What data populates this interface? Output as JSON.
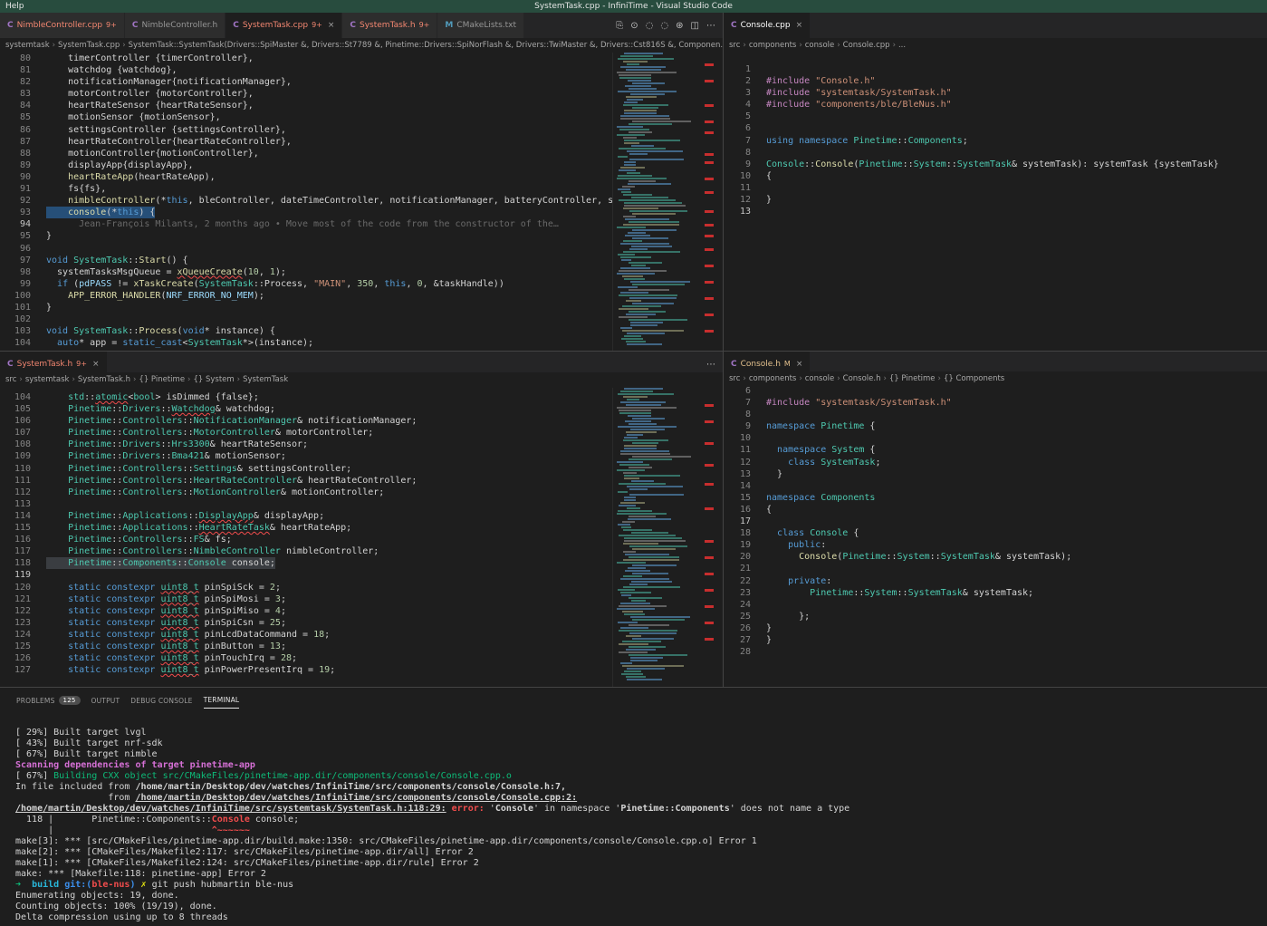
{
  "window": {
    "menu": "Help",
    "title": "SystemTask.cpp - InfiniTime - Visual Studio Code"
  },
  "colors": {
    "titlebar": "#284c3e",
    "error": "#f14c4c",
    "keyword": "#569cd6",
    "type": "#4ec9b0"
  },
  "top_left": {
    "tabs": [
      {
        "icon": "C",
        "label": "NimbleController.cpp",
        "badge": "9+",
        "state": "error"
      },
      {
        "icon": "C",
        "label": "NimbleController.h",
        "badge": "",
        "state": "normal"
      },
      {
        "icon": "C",
        "label": "SystemTask.cpp",
        "badge": "9+",
        "state": "active-error"
      },
      {
        "icon": "C",
        "label": "SystemTask.h",
        "badge": "9+",
        "state": "error"
      },
      {
        "icon": "M",
        "label": "CMakeLists.txt",
        "badge": "",
        "state": "normal"
      }
    ],
    "breadcrumb": [
      "systemtask",
      "SystemTask.cpp",
      "SystemTask::SystemTask(Drivers::SpiMaster &, Drivers::St7789 &, Pinetime::Drivers::SpiNorFlash &, Drivers::TwiMaster &, Drivers::Cst816S &, Componen..."
    ],
    "blame": "Jean-François Milants, 2 months ago • Move most of the code from the constructor of the…"
  },
  "top_right": {
    "tabs": [
      {
        "icon": "C",
        "label": "Console.cpp",
        "badge": "",
        "state": "active"
      }
    ],
    "breadcrumb": [
      "src",
      "components",
      "console",
      "Console.cpp",
      "..."
    ]
  },
  "bottom_left": {
    "tabs": [
      {
        "icon": "C",
        "label": "SystemTask.h",
        "badge": "9+",
        "state": "active-error"
      }
    ],
    "breadcrumb": [
      "src",
      "systemtask",
      "SystemTask.h",
      "{} Pinetime",
      "{} System",
      "SystemTask"
    ]
  },
  "bottom_right": {
    "tabs": [
      {
        "icon": "C",
        "label": "Console.h",
        "badge": "M",
        "state": "active-mod"
      }
    ],
    "breadcrumb": [
      "src",
      "components",
      "console",
      "Console.h",
      "{} Pinetime",
      "{} Components"
    ]
  },
  "panel": {
    "tabs": [
      {
        "label": "PROBLEMS",
        "badge": "125"
      },
      {
        "label": "OUTPUT",
        "badge": ""
      },
      {
        "label": "DEBUG CONSOLE",
        "badge": ""
      },
      {
        "label": "TERMINAL",
        "badge": ""
      }
    ],
    "active_tab": "TERMINAL"
  },
  "code": {
    "systemtask_cpp": [
      {
        "n": "80",
        "t": "    timerController {timerController},"
      },
      {
        "n": "81",
        "t": "    watchdog {watchdog},"
      },
      {
        "n": "82",
        "t": "    notificationManager{notificationManager},"
      },
      {
        "n": "83",
        "t": "    motorController {motorController},"
      },
      {
        "n": "84",
        "t": "    heartRateSensor {heartRateSensor},"
      },
      {
        "n": "85",
        "t": "    motionSensor {motionSensor},"
      },
      {
        "n": "86",
        "t": "    settingsController {settingsController},"
      },
      {
        "n": "87",
        "t": "    heartRateController{heartRateController},"
      },
      {
        "n": "88",
        "t": "    motionController{motionController},"
      },
      {
        "n": "89",
        "t": "    displayApp{displayApp},"
      },
      {
        "n": "90",
        "t": "    heartRateApp(heartRateApp),"
      },
      {
        "n": "91",
        "t": "    fs{fs},"
      },
      {
        "n": "92",
        "t": "    nimbleController(*this, bleController, dateTimeController, notificationManager, batteryController, spiN"
      },
      {
        "n": "93",
        "t": "    console(*this) {"
      },
      {
        "n": "94",
        "t": ""
      },
      {
        "n": "95",
        "t": "}"
      },
      {
        "n": "96",
        "t": ""
      },
      {
        "n": "97",
        "t": "void SystemTask::Start() {"
      },
      {
        "n": "98",
        "t": "  systemTasksMsgQueue = xQueueCreate(10, 1);"
      },
      {
        "n": "99",
        "t": "  if (pdPASS != xTaskCreate(SystemTask::Process, \"MAIN\", 350, this, 0, &taskHandle))"
      },
      {
        "n": "100",
        "t": "    APP_ERROR_HANDLER(NRF_ERROR_NO_MEM);"
      },
      {
        "n": "101",
        "t": "}"
      },
      {
        "n": "102",
        "t": ""
      },
      {
        "n": "103",
        "t": "void SystemTask::Process(void* instance) {"
      },
      {
        "n": "104",
        "t": "  auto* app = static_cast<SystemTask*>(instance);"
      }
    ],
    "console_cpp": [
      {
        "n": "1",
        "t": ""
      },
      {
        "n": "2",
        "t": "#include \"Console.h\""
      },
      {
        "n": "3",
        "t": "#include \"systemtask/SystemTask.h\""
      },
      {
        "n": "4",
        "t": "#include \"components/ble/BleNus.h\""
      },
      {
        "n": "5",
        "t": ""
      },
      {
        "n": "6",
        "t": ""
      },
      {
        "n": "7",
        "t": "using namespace Pinetime::Components;"
      },
      {
        "n": "8",
        "t": ""
      },
      {
        "n": "9",
        "t": "Console::Console(Pinetime::System::SystemTask& systemTask): systemTask {systemTask}"
      },
      {
        "n": "10",
        "t": "{"
      },
      {
        "n": "11",
        "t": ""
      },
      {
        "n": "12",
        "t": "}"
      },
      {
        "n": "13",
        "t": ""
      }
    ],
    "systemtask_h": [
      {
        "n": "104",
        "t": "    std::atomic<bool> isDimmed {false};"
      },
      {
        "n": "105",
        "t": "    Pinetime::Drivers::Watchdog& watchdog;"
      },
      {
        "n": "106",
        "t": "    Pinetime::Controllers::NotificationManager& notificationManager;"
      },
      {
        "n": "107",
        "t": "    Pinetime::Controllers::MotorController& motorController;"
      },
      {
        "n": "108",
        "t": "    Pinetime::Drivers::Hrs3300& heartRateSensor;"
      },
      {
        "n": "109",
        "t": "    Pinetime::Drivers::Bma421& motionSensor;"
      },
      {
        "n": "110",
        "t": "    Pinetime::Controllers::Settings& settingsController;"
      },
      {
        "n": "111",
        "t": "    Pinetime::Controllers::HeartRateController& heartRateController;"
      },
      {
        "n": "112",
        "t": "    Pinetime::Controllers::MotionController& motionController;"
      },
      {
        "n": "113",
        "t": ""
      },
      {
        "n": "114",
        "t": "    Pinetime::Applications::DisplayApp& displayApp;"
      },
      {
        "n": "115",
        "t": "    Pinetime::Applications::HeartRateTask& heartRateApp;"
      },
      {
        "n": "116",
        "t": "    Pinetime::Controllers::FS& fs;"
      },
      {
        "n": "117",
        "t": "    Pinetime::Controllers::NimbleController nimbleController;"
      },
      {
        "n": "118",
        "t": "    Pinetime::Components::Console console;"
      },
      {
        "n": "119",
        "t": ""
      },
      {
        "n": "120",
        "t": "    static constexpr uint8_t pinSpiSck = 2;"
      },
      {
        "n": "121",
        "t": "    static constexpr uint8_t pinSpiMosi = 3;"
      },
      {
        "n": "122",
        "t": "    static constexpr uint8_t pinSpiMiso = 4;"
      },
      {
        "n": "123",
        "t": "    static constexpr uint8_t pinSpiCsn = 25;"
      },
      {
        "n": "124",
        "t": "    static constexpr uint8_t pinLcdDataCommand = 18;"
      },
      {
        "n": "125",
        "t": "    static constexpr uint8_t pinButton = 13;"
      },
      {
        "n": "126",
        "t": "    static constexpr uint8_t pinTouchIrq = 28;"
      },
      {
        "n": "127",
        "t": "    static constexpr uint8_t pinPowerPresentIrq = 19;"
      }
    ],
    "console_h": [
      {
        "n": "6",
        "t": ""
      },
      {
        "n": "7",
        "t": "#include \"systemtask/SystemTask.h\""
      },
      {
        "n": "8",
        "t": ""
      },
      {
        "n": "9",
        "t": "namespace Pinetime {"
      },
      {
        "n": "10",
        "t": ""
      },
      {
        "n": "11",
        "t": "  namespace System {"
      },
      {
        "n": "12",
        "t": "    class SystemTask;"
      },
      {
        "n": "13",
        "t": "  }"
      },
      {
        "n": "14",
        "t": ""
      },
      {
        "n": "15",
        "t": "namespace Components"
      },
      {
        "n": "16",
        "t": "{"
      },
      {
        "n": "17",
        "t": ""
      },
      {
        "n": "18",
        "t": "  class Console {"
      },
      {
        "n": "19",
        "t": "    public:"
      },
      {
        "n": "20",
        "t": "      Console(Pinetime::System::SystemTask& systemTask);"
      },
      {
        "n": "21",
        "t": ""
      },
      {
        "n": "22",
        "t": "    private:"
      },
      {
        "n": "23",
        "t": "        Pinetime::System::SystemTask& systemTask;"
      },
      {
        "n": "24",
        "t": ""
      },
      {
        "n": "25",
        "t": "      };"
      },
      {
        "n": "26",
        "t": "}"
      },
      {
        "n": "27",
        "t": "}"
      },
      {
        "n": "28",
        "t": ""
      }
    ]
  },
  "terminal": [
    {
      "t": "[ 29%] Built target lvgl",
      "s": ""
    },
    {
      "t": "[ 43%] Built target nrf-sdk",
      "s": ""
    },
    {
      "t": "[ 67%] Built target nimble",
      "s": ""
    },
    {
      "t": "Scanning dependencies of target pinetime-app",
      "s": "mag"
    },
    {
      "t": "[ 67%] Building CXX object src/CMakeFiles/pinetime-app.dir/components/console/Console.cpp.o",
      "s": "build"
    },
    {
      "t": "In file included from /home/martin/Desktop/dev/watches/InfiniTime/src/components/console/Console.h:7,",
      "s": "incl1"
    },
    {
      "t": "                 from /home/martin/Desktop/dev/watches/InfiniTime/src/components/console/Console.cpp:2:",
      "s": "incl2"
    },
    {
      "t": "/home/martin/Desktop/dev/watches/InfiniTime/src/systemtask/SystemTask.h:118:29: error: 'Console' in namespace 'Pinetime::Components' does not name a type",
      "s": "error"
    },
    {
      "t": "  118 |       Pinetime::Components::Console console;",
      "s": "src"
    },
    {
      "t": "      |                             ^~~~~~~",
      "s": "caret"
    },
    {
      "t": "make[3]: *** [src/CMakeFiles/pinetime-app.dir/build.make:1350: src/CMakeFiles/pinetime-app.dir/components/console/Console.cpp.o] Error 1",
      "s": ""
    },
    {
      "t": "make[2]: *** [CMakeFiles/Makefile2:117: src/CMakeFiles/pinetime-app.dir/all] Error 2",
      "s": ""
    },
    {
      "t": "make[1]: *** [CMakeFiles/Makefile2:124: src/CMakeFiles/pinetime-app.dir/rule] Error 2",
      "s": ""
    },
    {
      "t": "make: *** [Makefile:118: pinetime-app] Error 2",
      "s": ""
    },
    {
      "t": "➜  build git:(ble-nus) ✗ git push hubmartin ble-nus",
      "s": "prompt"
    },
    {
      "t": "Enumerating objects: 19, done.",
      "s": ""
    },
    {
      "t": "Counting objects: 100% (19/19), done.",
      "s": ""
    },
    {
      "t": "Delta compression using up to 8 threads",
      "s": ""
    }
  ]
}
